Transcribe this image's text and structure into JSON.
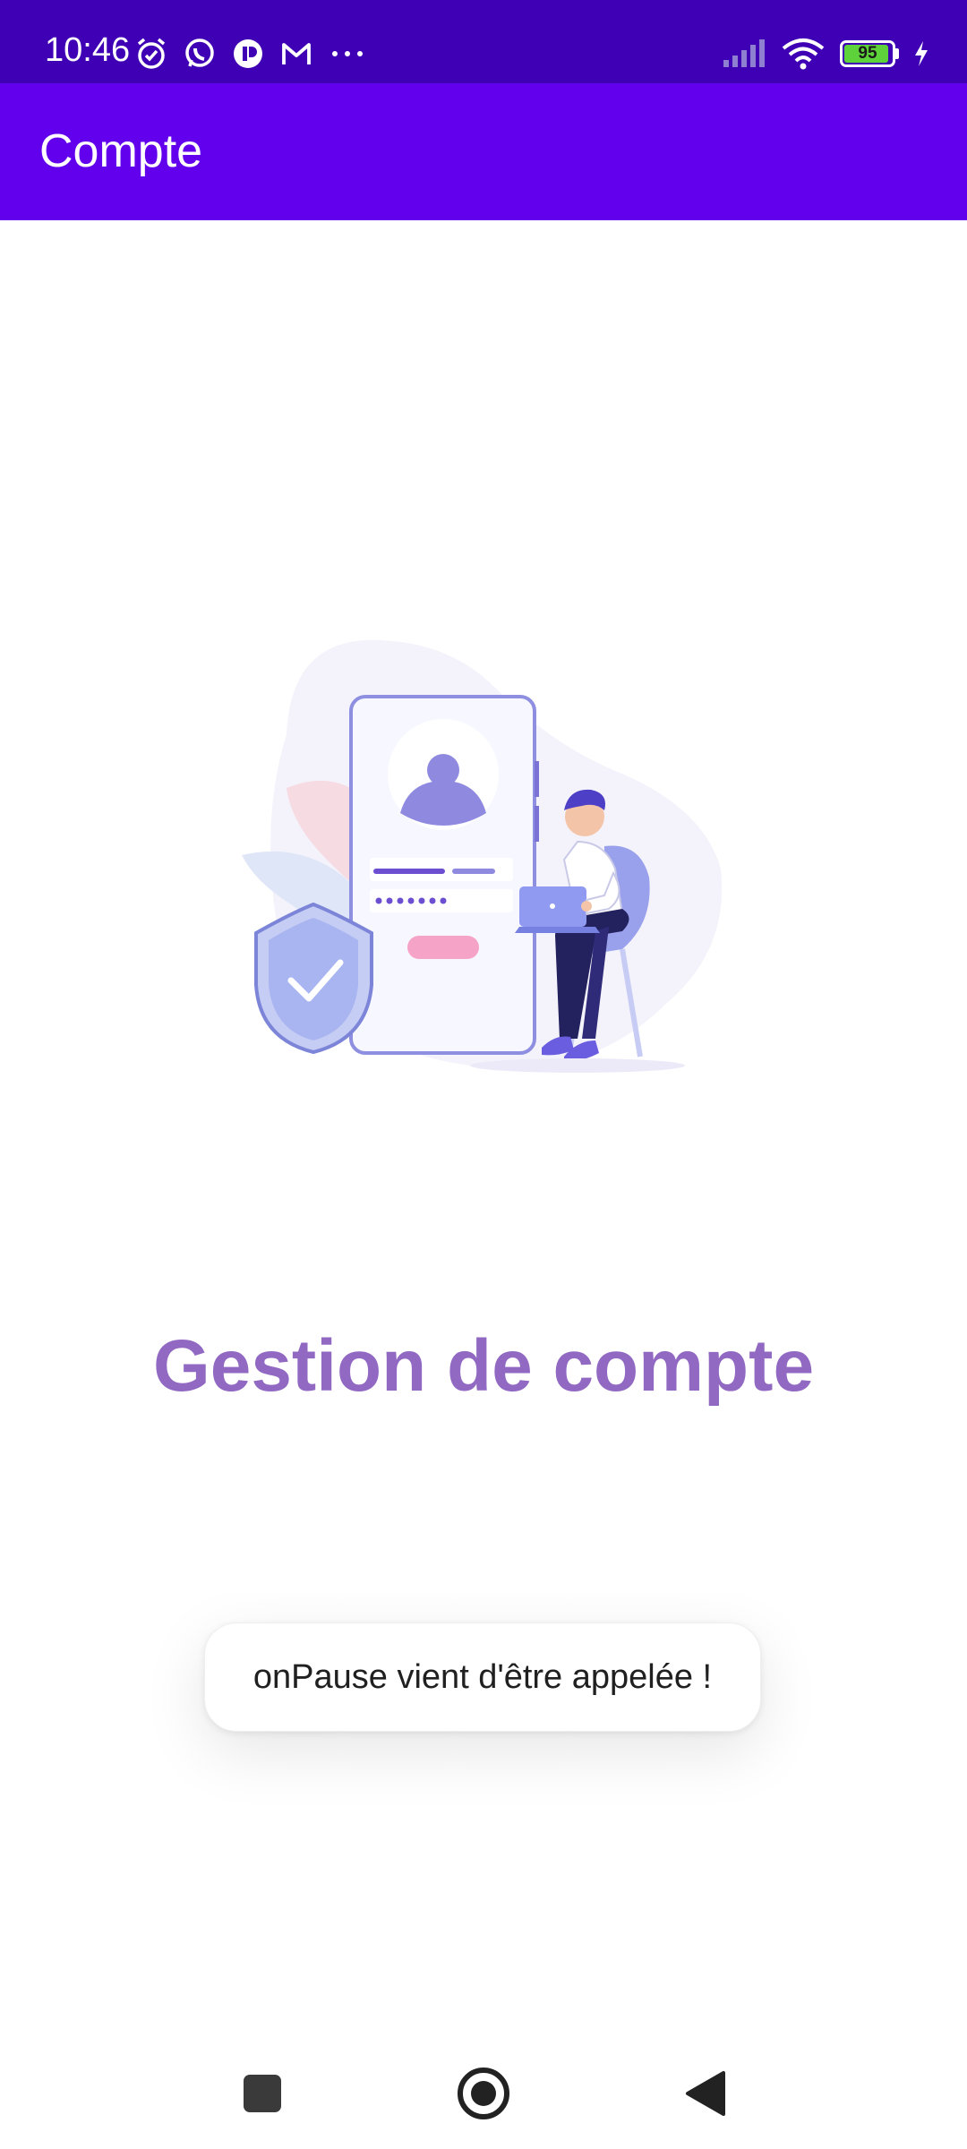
{
  "status_bar": {
    "time": "10:46",
    "left_icons": [
      "alarm-icon",
      "whatsapp-icon",
      "app-notification-icon",
      "gmail-icon",
      "more-dots-icon"
    ],
    "right_icons": [
      "signal-icon",
      "wifi-icon",
      "battery-icon",
      "charging-icon"
    ],
    "battery_level": "95",
    "battery_fraction": 0.95,
    "background": "#3f00b5"
  },
  "app_bar": {
    "title": "Compte",
    "background": "#6200ee"
  },
  "main": {
    "illustration": "account-security-illustration",
    "headline": "Gestion de compte",
    "headline_color": "#9169c3"
  },
  "toast": {
    "message": "onPause vient d'être appelée !"
  },
  "nav_bar": {
    "buttons": [
      "recents-square-icon",
      "home-circle-icon",
      "back-triangle-icon"
    ]
  }
}
